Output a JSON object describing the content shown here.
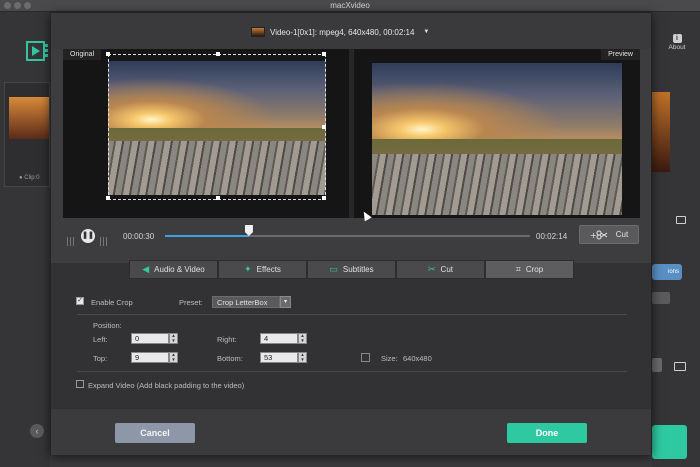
{
  "app": {
    "title": "macXvideo"
  },
  "sidebar": {
    "clip_label": "● Clip:0"
  },
  "right_panel": {
    "about_label": "About",
    "options_label": "ions"
  },
  "video_selector": {
    "label": "Video-1[0x1]: mpeg4, 640x480, 00:02:14"
  },
  "preview": {
    "original_label": "Original",
    "preview_label": "Preview"
  },
  "timeline": {
    "current_time": "00:00:30",
    "end_time": "00:02:14",
    "progress": 0.23,
    "cut_label": "Cut"
  },
  "tabs": [
    {
      "label": "Audio & Video",
      "icon": "speaker-icon"
    },
    {
      "label": "Effects",
      "icon": "magic-wand-icon"
    },
    {
      "label": "Subtitles",
      "icon": "subtitles-icon"
    },
    {
      "label": "Cut",
      "icon": "scissors-icon"
    },
    {
      "label": "Crop",
      "icon": "crop-icon",
      "active": true
    }
  ],
  "crop": {
    "enable_label": "Enable Crop",
    "enabled": true,
    "preset_label": "Preset:",
    "preset_value": "Crop LetterBox",
    "position_label": "Position:",
    "left_label": "Left:",
    "left_value": "0",
    "right_label": "Right:",
    "right_value": "4",
    "top_label": "Top:",
    "top_value": "9",
    "bottom_label": "Bottom:",
    "bottom_value": "53",
    "size_label": "Size:",
    "size_value": "640x480",
    "expand_label": "Expand Video (Add black padding to the video)",
    "expand_enabled": false
  },
  "footer": {
    "cancel_label": "Cancel",
    "done_label": "Done"
  },
  "colors": {
    "accent": "#2ec9a0",
    "progress": "#3fa0e6",
    "cancel": "#8e97a8"
  }
}
